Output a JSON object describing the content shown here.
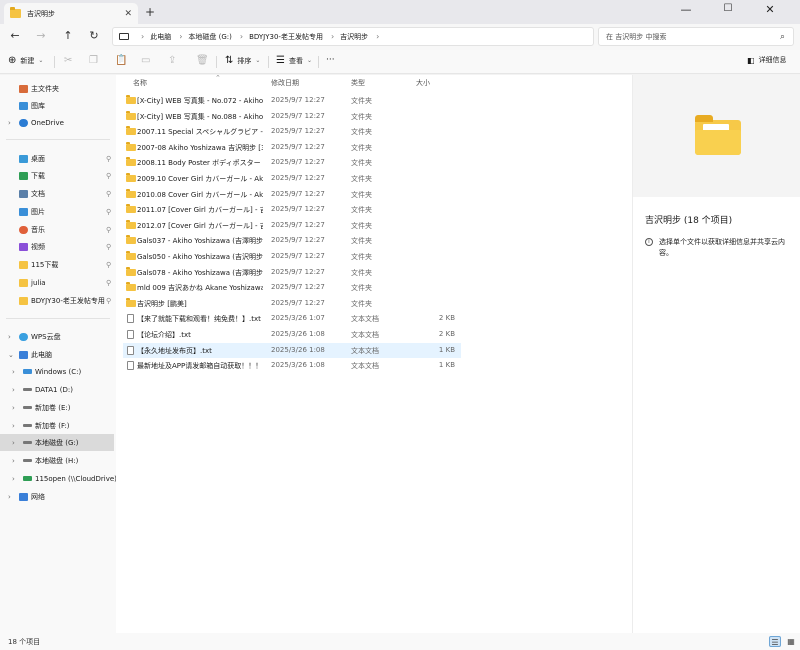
{
  "tab": {
    "title": "吉沢明步",
    "close": "✕",
    "new": "+"
  },
  "window": {
    "minimize": "—",
    "maximize": "☐",
    "close": "✕"
  },
  "nav": {
    "back": "←",
    "forward": "→",
    "up": "↑",
    "refresh": "↻"
  },
  "breadcrumb": [
    "此电脑",
    "本地磁盘 (G:)",
    "BDYJY30-老王发帖专用",
    "吉沢明步"
  ],
  "search": {
    "placeholder": "在 吉沢明步 中搜索"
  },
  "toolbar": {
    "new_label": "新建",
    "sort_label": "排序",
    "view_label": "查看",
    "more_label": "···",
    "details_label": "详细信息"
  },
  "sidebar": {
    "items": [
      {
        "label": "主文件夹",
        "icon": "home-icon",
        "color": "#d86b3a"
      },
      {
        "label": "图库",
        "icon": "gallery-icon",
        "color": "#3a8fd8"
      },
      {
        "label": "OneDrive",
        "icon": "cloud-icon",
        "color": "#2b7cd3"
      },
      {
        "label": "桌面",
        "icon": "desktop-icon",
        "color": "#3a9ad8"
      },
      {
        "label": "下载",
        "icon": "download-icon",
        "color": "#2f9e55"
      },
      {
        "label": "文档",
        "icon": "documents-icon",
        "color": "#5a7fa8"
      },
      {
        "label": "图片",
        "icon": "pictures-icon",
        "color": "#3a8fd8"
      },
      {
        "label": "音乐",
        "icon": "music-icon",
        "color": "#e0603a"
      },
      {
        "label": "视频",
        "icon": "videos-icon",
        "color": "#8a4fd8"
      },
      {
        "label": "115下载",
        "icon": "folder-icon",
        "color": "#f5c342"
      },
      {
        "label": "julia",
        "icon": "folder-icon",
        "color": "#f5c342"
      },
      {
        "label": "BDYJY30-老王发帖专用",
        "icon": "folder-icon",
        "color": "#f5c342"
      },
      {
        "label": "WPS云盘",
        "icon": "cloud-icon",
        "color": "#3aa0e0"
      },
      {
        "label": "此电脑",
        "icon": "pc-icon",
        "color": "#3a7fd8"
      },
      {
        "label": "Windows (C:)",
        "icon": "drive-icon",
        "color": "#3a8fd8"
      },
      {
        "label": "DATA1 (D:)",
        "icon": "drive-icon",
        "color": "#777777"
      },
      {
        "label": "新加卷 (E:)",
        "icon": "drive-icon",
        "color": "#777777"
      },
      {
        "label": "新加卷 (F:)",
        "icon": "drive-icon",
        "color": "#777777"
      },
      {
        "label": "本地磁盘 (G:)",
        "icon": "drive-icon",
        "color": "#777777"
      },
      {
        "label": "本地磁盘 (H:)",
        "icon": "drive-icon",
        "color": "#777777"
      },
      {
        "label": "115open (\\\\CloudDrive)",
        "icon": "network-drive-icon",
        "color": "#2f9e55"
      },
      {
        "label": "网络",
        "icon": "network-icon",
        "color": "#3a7fd8"
      }
    ]
  },
  "columns": {
    "name": "名称",
    "date": "修改日期",
    "type": "类型",
    "size": "大小"
  },
  "files": [
    {
      "name": "[X-City] WEB 写真集 - No.072 - Akiho...",
      "date": "2025/9/7 12:27",
      "type": "文件夹",
      "size": "",
      "kind": "folder"
    },
    {
      "name": "[X-City] WEB 写真集 - No.088 - Akiho...",
      "date": "2025/9/7 12:27",
      "type": "文件夹",
      "size": "",
      "kind": "folder"
    },
    {
      "name": "2007.11 Special スペシャルグラビア - ...",
      "date": "2025/9/7 12:27",
      "type": "文件夹",
      "size": "",
      "kind": "folder"
    },
    {
      "name": "2007-08 Akiho Yoshizawa 吉沢明步 [3...",
      "date": "2025/9/7 12:27",
      "type": "文件夹",
      "size": "",
      "kind": "folder"
    },
    {
      "name": "2008.11 Body Poster ボディポスター -...",
      "date": "2025/9/7 12:27",
      "type": "文件夹",
      "size": "",
      "kind": "folder"
    },
    {
      "name": "2009.10 Cover Girl カバーガール - Aki...",
      "date": "2025/9/7 12:27",
      "type": "文件夹",
      "size": "",
      "kind": "folder"
    },
    {
      "name": "2010.08 Cover Girl カバーガール - Aki...",
      "date": "2025/9/7 12:27",
      "type": "文件夹",
      "size": "",
      "kind": "folder"
    },
    {
      "name": "2011.07 [Cover Girl カバーガール] - 吉...",
      "date": "2025/9/7 12:27",
      "type": "文件夹",
      "size": "",
      "kind": "folder"
    },
    {
      "name": "2012.07 [Cover Girl カバーガール] - 吉...",
      "date": "2025/9/7 12:27",
      "type": "文件夹",
      "size": "",
      "kind": "folder"
    },
    {
      "name": "Gals037 - Akiho Yoshizawa (吉澤明步)...",
      "date": "2025/9/7 12:27",
      "type": "文件夹",
      "size": "",
      "kind": "folder"
    },
    {
      "name": "Gals050 - Akiho Yoshizawa (吉沢明步 ...",
      "date": "2025/9/7 12:27",
      "type": "文件夹",
      "size": "",
      "kind": "folder"
    },
    {
      "name": "Gals078 - Akiho Yoshizawa (吉澤明步 ...",
      "date": "2025/9/7 12:27",
      "type": "文件夹",
      "size": "",
      "kind": "folder"
    },
    {
      "name": "mld 009 吉沢あかね Akane Yoshizawa...",
      "date": "2025/9/7 12:27",
      "type": "文件夹",
      "size": "",
      "kind": "folder"
    },
    {
      "name": "吉沢明步 [鹏美]",
      "date": "2025/9/7 12:27",
      "type": "文件夹",
      "size": "",
      "kind": "folder"
    },
    {
      "name": "【来了就能下载和观看！纯免费！】.txt",
      "date": "2025/3/26 1:07",
      "type": "文本文档",
      "size": "2 KB",
      "kind": "txt"
    },
    {
      "name": "【论坛介绍】.txt",
      "date": "2025/3/26 1:08",
      "type": "文本文档",
      "size": "2 KB",
      "kind": "txt"
    },
    {
      "name": "【永久地址发布页】.txt",
      "date": "2025/3/26 1:08",
      "type": "文本文档",
      "size": "1 KB",
      "kind": "txt"
    },
    {
      "name": "最新地址及APP请发邮箱自动获取！！！...",
      "date": "2025/3/26 1:08",
      "type": "文本文档",
      "size": "1 KB",
      "kind": "txt"
    }
  ],
  "details": {
    "title": "吉沢明步 (18 个项目)",
    "info_icon": "i",
    "info_text": "选择单个文件以获取详细信息并共享云内容。"
  },
  "status": {
    "count": "18 个项目"
  },
  "colors": {
    "selection": "#e5f3ff",
    "accent": "#0067c0",
    "folder": "#f5c342"
  }
}
